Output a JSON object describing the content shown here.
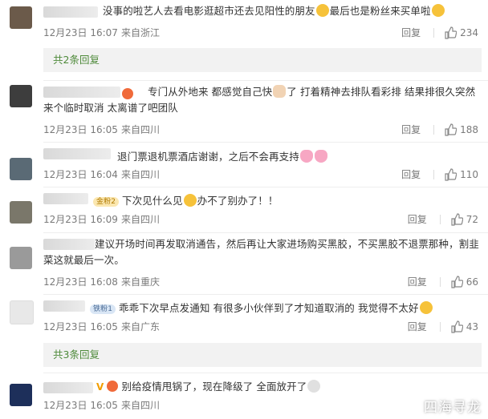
{
  "comments": [
    {
      "text": "没事的啦艺人去看电影逛超市还去见阳性的朋友",
      "text_after": "最后也是粉丝来买单啦",
      "date": "12月23日 16:07",
      "location": "来自浙江",
      "reply": "回复",
      "likes": "234"
    },
    {
      "text": "专门从外地来 都感觉自己快",
      "text_mid": "了 打着精神去排队看彩排 结果排很久突然来个临时取消 太离谱了吧团队",
      "date": "12月23日 16:05",
      "location": "来自四川",
      "likes": "188"
    },
    {
      "text": "退门票退机票酒店谢谢，之后不会再支持",
      "date": "12月23日 16:04",
      "location": "来自四川",
      "likes": "110"
    },
    {
      "badge": "金粉2",
      "text": "下次见什么见",
      "text_after": "办不了别办了！！",
      "date": "12月23日 16:09",
      "location": "来自四川",
      "likes": "72"
    },
    {
      "text": "建议开场时间再发取消通告，然后再让大家进场购买黑胶，不买黑胶不退票那种，割韭菜这就最后一次。",
      "date": "12月23日 16:08",
      "location": "来自重庆",
      "likes": "66"
    },
    {
      "badge": "铁粉1",
      "text": "乖乖下次早点发通知 有很多小伙伴到了才知道取消的 我觉得不太好",
      "date": "12月23日 16:05",
      "location": "来自广东",
      "likes": "43"
    },
    {
      "vip": "V",
      "text": "别给疫情甩锅了，现在降级了 全面放开了",
      "date": "12月23日 16:05",
      "location": "来自四川"
    }
  ],
  "expand1": "共2条回复",
  "expand2": "共3条回复",
  "reply_label": "回复",
  "watermark": "四海寻龙"
}
